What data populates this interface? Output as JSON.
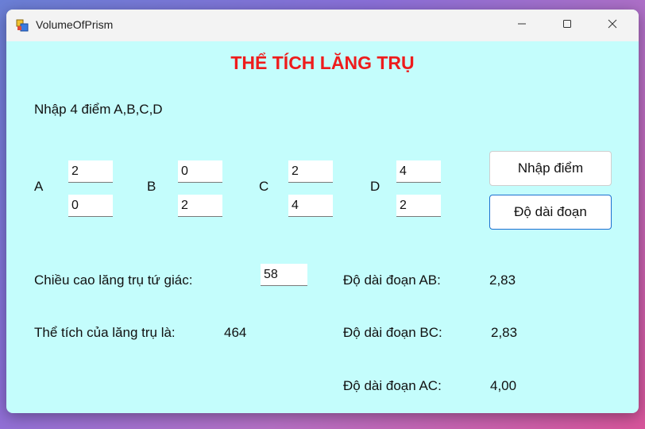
{
  "window": {
    "title": "VolumeOfPrism"
  },
  "heading": "THỂ TÍCH LĂNG TRỤ",
  "prompt": "Nhập 4 điểm A,B,C,D",
  "points": {
    "A": {
      "label": "A",
      "x": "2",
      "y": "0"
    },
    "B": {
      "label": "B",
      "x": "0",
      "y": "2"
    },
    "C": {
      "label": "C",
      "x": "2",
      "y": "4"
    },
    "D": {
      "label": "D",
      "x": "4",
      "y": "2"
    }
  },
  "buttons": {
    "enter_points": "Nhập điểm",
    "segment_length": "Độ dài đoạn"
  },
  "height": {
    "label": "Chiều cao lăng trụ tứ giác:",
    "value": "58"
  },
  "volume": {
    "label": "Thể tích của lăng trụ là:",
    "value": "464"
  },
  "segments": {
    "AB": {
      "label": "Độ dài đoạn AB:",
      "value": "2,83"
    },
    "BC": {
      "label": "Độ dài đoạn BC:",
      "value": "2,83"
    },
    "AC": {
      "label": "Độ dài đoạn AC:",
      "value": "4,00"
    }
  },
  "icons": {
    "app": "app-icon",
    "minimize": "minimize-icon",
    "maximize": "maximize-icon",
    "close": "close-icon"
  }
}
